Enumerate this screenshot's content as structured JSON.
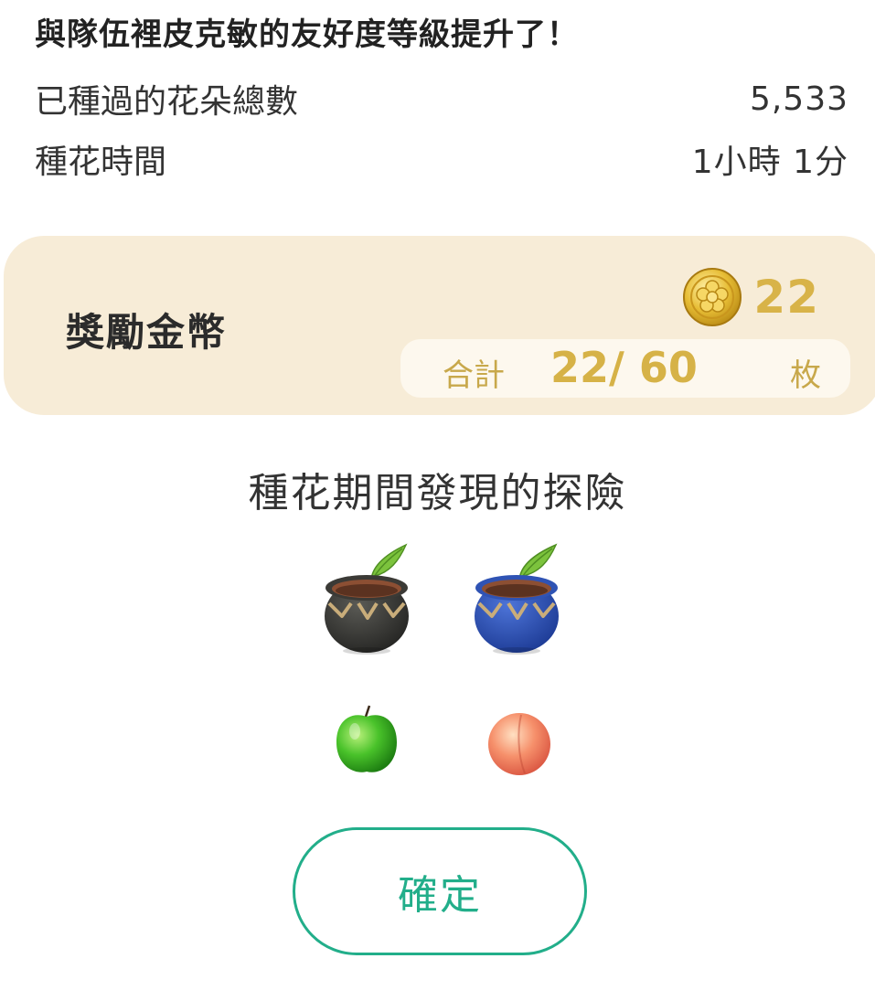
{
  "header": {
    "friendship_message": "與隊伍裡皮克敏的友好度等級提升了！"
  },
  "stats": [
    {
      "label": "已種過的花朵總數",
      "value": "5,533"
    },
    {
      "label": "種花時間",
      "value": "1小時 1分"
    }
  ],
  "reward": {
    "title": "獎勵金幣",
    "coin_icon": "coin-icon",
    "amount": "22",
    "total_label": "合計",
    "total_value": "22/ 60",
    "total_unit": "枚"
  },
  "adventures": {
    "heading": "種花期間發現的探險",
    "items": [
      {
        "icon": "black-planter-pot-icon"
      },
      {
        "icon": "blue-planter-pot-icon"
      },
      {
        "icon": "green-apple-icon"
      },
      {
        "icon": "peach-icon"
      }
    ]
  },
  "confirm_label": "確定",
  "colors": {
    "card_background": "#f7ecd7",
    "gold": "#d6b247",
    "accent_green": "#22ae8a"
  }
}
